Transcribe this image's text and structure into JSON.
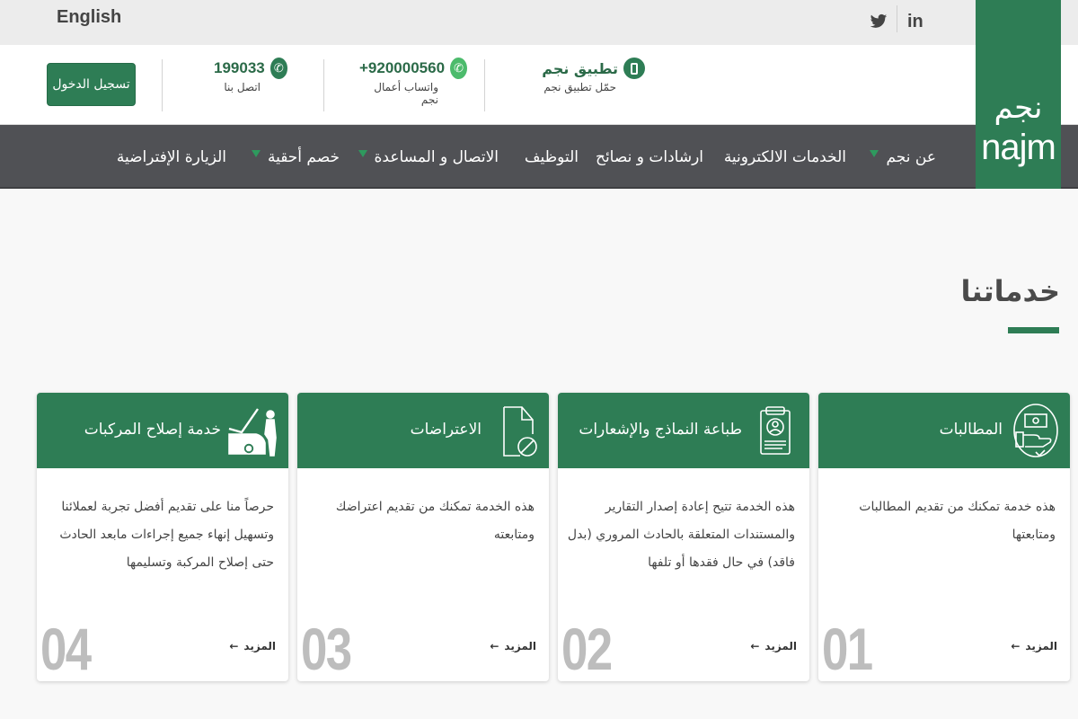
{
  "topbar": {
    "language_label": "English",
    "social": [
      {
        "name": "twitter-icon",
        "glyph": "🐦"
      },
      {
        "name": "linkedin-icon",
        "glyph": "in"
      }
    ]
  },
  "brand": {
    "logo_arabic": "نجم",
    "logo_english": "najm",
    "color": "#2e7d55"
  },
  "header": {
    "login_button": "تسجيل الدخول",
    "contacts": [
      {
        "icon": "phone-icon",
        "title": "199033",
        "subtitle": "اتصل بنا"
      },
      {
        "icon": "whatsapp-icon",
        "title": "+920000560",
        "subtitle": "واتساب أعمال نجم"
      },
      {
        "icon": "mobile-app-icon",
        "title": "تطبيق نجم",
        "subtitle": "حمّل تطبيق نجم"
      }
    ]
  },
  "nav": {
    "items": [
      {
        "label": "عن نجم",
        "dropdown": true
      },
      {
        "label": "الخدمات الالكترونية",
        "dropdown": false
      },
      {
        "label": "ارشادات و نصائح",
        "dropdown": false
      },
      {
        "label": "التوظيف",
        "dropdown": false
      },
      {
        "label": "الاتصال و المساعدة",
        "dropdown": true
      },
      {
        "label": "خصم أحقية",
        "dropdown": true
      },
      {
        "label": "الزيارة الإفتراضية",
        "dropdown": false
      }
    ]
  },
  "services": {
    "title": "خدماتنا",
    "more_label": "المزيد",
    "cards": [
      {
        "number": "01",
        "title": "المطالبات",
        "icon": "claims-money-hand-icon",
        "description": "هذه خدمة تمكنك من تقديم المطالبات ومتابعتها"
      },
      {
        "number": "02",
        "title": "طباعة النماذج والإشعارات",
        "icon": "clipboard-form-icon",
        "description": "هذه الخدمة تتيح إعادة إصدار التقارير والمستندات المتعلقة بالحادث المروري (بدل فاقد) في حال فقدها أو تلفها"
      },
      {
        "number": "03",
        "title": "الاعتراضات",
        "icon": "objection-document-icon",
        "description": "هذه الخدمة تمكنك من تقديم اعتراضك ومتابعته"
      },
      {
        "number": "04",
        "title": "خدمة إصلاح المركبات",
        "icon": "car-repair-mechanic-icon",
        "description": "حرصاً منا على تقديم أفضل تجربة لعملائنا وتسهيل إنهاء جميع إجراءات مابعد الحادث حتى إصلاح المركبة وتسليمها"
      }
    ]
  }
}
